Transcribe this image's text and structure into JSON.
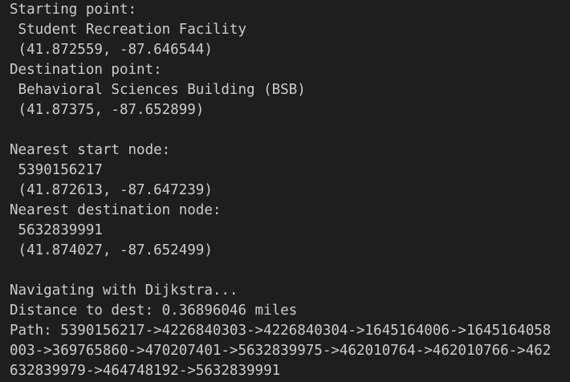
{
  "terminal": {
    "lines": [
      "Starting point:",
      " Student Recreation Facility",
      " (41.872559, -87.646544)",
      "Destination point:",
      " Behavioral Sciences Building (BSB)",
      " (41.87375, -87.652899)",
      "",
      "Nearest start node:",
      " 5390156217",
      " (41.872613, -87.647239)",
      "Nearest destination node:",
      " 5632839991",
      " (41.874027, -87.652499)",
      "",
      "Navigating with Dijkstra...",
      "Distance to dest: 0.36896046 miles",
      "Path: 5390156217->4226840303->4226840304->1645164006->1645164058",
      "003->369765860->470207401->5632839975->462010764->462010766->462",
      "632839979->464748192->5632839991"
    ]
  },
  "colors": {
    "background": "#1e1e1e",
    "foreground": "#cccccc"
  }
}
